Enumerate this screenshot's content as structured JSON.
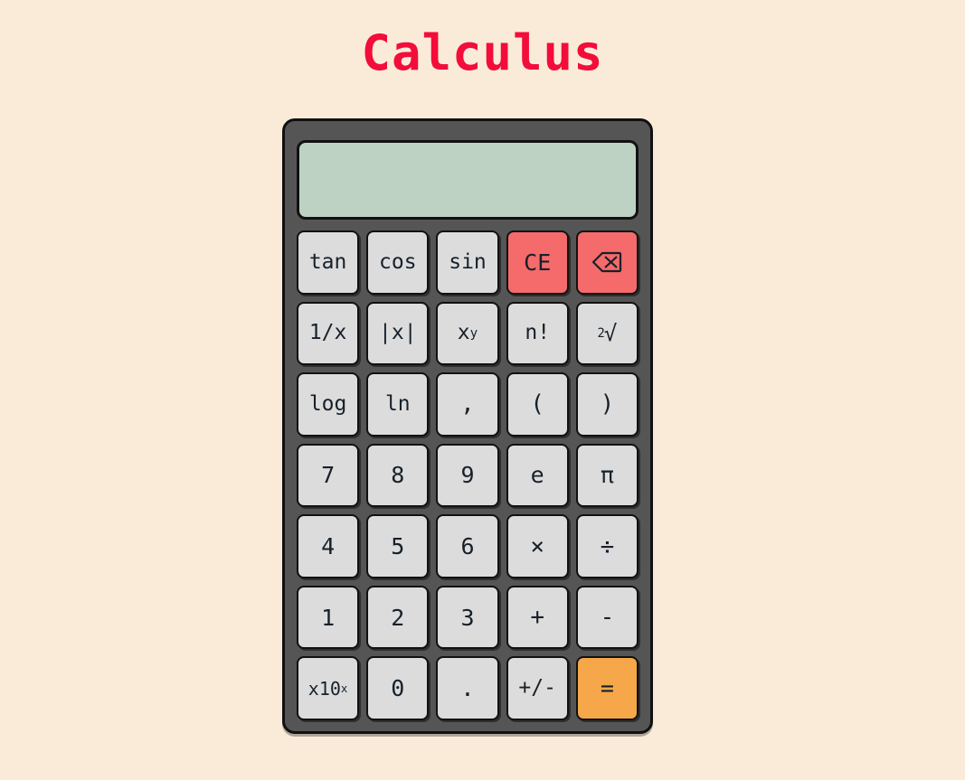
{
  "app": {
    "title": "Calculus",
    "title_color": "#f20d3a",
    "page_background": "#faebd9",
    "body_color": "#555555",
    "border_color": "#111111"
  },
  "display": {
    "value": "",
    "background": "#bdd2c2",
    "placeholder": ""
  },
  "palette": {
    "key_default": "#dcdcdc",
    "key_danger": "#f56a6a",
    "key_accent": "#f5a749",
    "key_text": "#17202a"
  },
  "keypad": {
    "rows": [
      [
        {
          "name": "key-tan",
          "label": "tan",
          "style": "fn",
          "icon": ""
        },
        {
          "name": "key-cos",
          "label": "cos",
          "style": "fn",
          "icon": ""
        },
        {
          "name": "key-sin",
          "label": "sin",
          "style": "fn",
          "icon": ""
        },
        {
          "name": "key-clear-entry",
          "label": "CE",
          "style": "danger",
          "icon": ""
        },
        {
          "name": "key-backspace",
          "label": "⌫",
          "style": "danger",
          "icon": "backspace-icon"
        }
      ],
      [
        {
          "name": "key-reciprocal",
          "label": "1/x",
          "style": "fn",
          "icon": ""
        },
        {
          "name": "key-absolute",
          "label": "|x|",
          "style": "fn",
          "icon": ""
        },
        {
          "name": "key-power",
          "label": "x^y",
          "style": "fn",
          "icon": ""
        },
        {
          "name": "key-factorial",
          "label": "n!",
          "style": "fn",
          "icon": ""
        },
        {
          "name": "key-square-root",
          "label": "2√",
          "style": "fn",
          "icon": ""
        }
      ],
      [
        {
          "name": "key-log",
          "label": "log",
          "style": "fn",
          "icon": ""
        },
        {
          "name": "key-ln",
          "label": "ln",
          "style": "fn",
          "icon": ""
        },
        {
          "name": "key-comma",
          "label": ",",
          "style": "sym",
          "icon": ""
        },
        {
          "name": "key-paren-open",
          "label": "(",
          "style": "sym",
          "icon": ""
        },
        {
          "name": "key-paren-close",
          "label": ")",
          "style": "sym",
          "icon": ""
        }
      ],
      [
        {
          "name": "key-7",
          "label": "7",
          "style": "",
          "icon": ""
        },
        {
          "name": "key-8",
          "label": "8",
          "style": "",
          "icon": ""
        },
        {
          "name": "key-9",
          "label": "9",
          "style": "",
          "icon": ""
        },
        {
          "name": "key-euler",
          "label": "e",
          "style": "",
          "icon": ""
        },
        {
          "name": "key-pi",
          "label": "π",
          "style": "",
          "icon": ""
        }
      ],
      [
        {
          "name": "key-4",
          "label": "4",
          "style": "",
          "icon": ""
        },
        {
          "name": "key-5",
          "label": "5",
          "style": "",
          "icon": ""
        },
        {
          "name": "key-6",
          "label": "6",
          "style": "",
          "icon": ""
        },
        {
          "name": "key-multiply",
          "label": "×",
          "style": "sym",
          "icon": ""
        },
        {
          "name": "key-divide",
          "label": "÷",
          "style": "sym",
          "icon": ""
        }
      ],
      [
        {
          "name": "key-1",
          "label": "1",
          "style": "",
          "icon": ""
        },
        {
          "name": "key-2",
          "label": "2",
          "style": "",
          "icon": ""
        },
        {
          "name": "key-3",
          "label": "3",
          "style": "",
          "icon": ""
        },
        {
          "name": "key-add",
          "label": "+",
          "style": "sym",
          "icon": ""
        },
        {
          "name": "key-subtract",
          "label": "-",
          "style": "sym",
          "icon": ""
        }
      ],
      [
        {
          "name": "key-exponent-ten",
          "label": "x10^x",
          "style": "small",
          "icon": ""
        },
        {
          "name": "key-0",
          "label": "0",
          "style": "",
          "icon": ""
        },
        {
          "name": "key-decimal",
          "label": ".",
          "style": "sym",
          "icon": ""
        },
        {
          "name": "key-sign-toggle",
          "label": "+/-",
          "style": "fn",
          "icon": ""
        },
        {
          "name": "key-equals",
          "label": "=",
          "style": "accent",
          "icon": ""
        }
      ]
    ]
  }
}
